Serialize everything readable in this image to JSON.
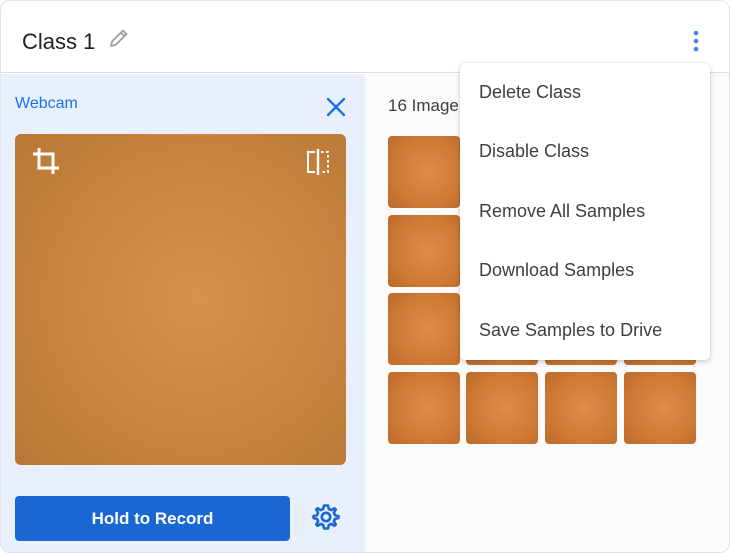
{
  "class_card": {
    "title": "Class 1",
    "edit_icon": "pencil-icon",
    "options_icon": "more-vert-icon"
  },
  "webcam": {
    "label": "Webcam",
    "close_icon": "close-icon",
    "crop_icon": "crop-icon",
    "flip_icon": "flip-icon",
    "record_button": "Hold to Record",
    "settings_icon": "gear-icon"
  },
  "samples": {
    "count_label": "16 Image"
  },
  "menu": {
    "items": [
      "Delete Class",
      "Disable Class",
      "Remove All Samples",
      "Download Samples",
      "Save Samples to Drive"
    ]
  },
  "colors": {
    "accent": "#1967d2",
    "link": "#1a73e8",
    "panel_bg": "#e8f0fe",
    "thumb": "#cf7a35"
  }
}
